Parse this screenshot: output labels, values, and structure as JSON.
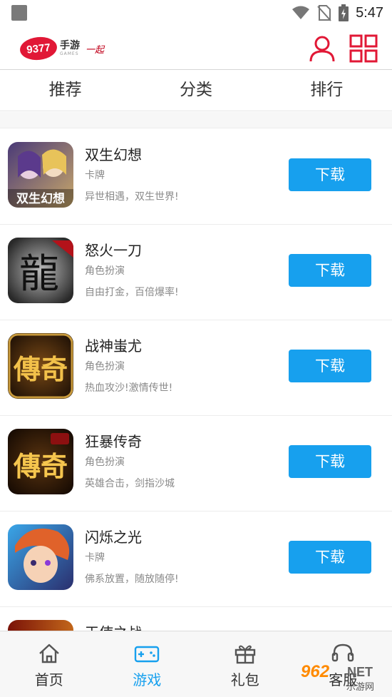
{
  "status_bar": {
    "time": "5:47",
    "icons": [
      "app-notification-icon",
      "wifi-icon",
      "no-sim-icon",
      "battery-charging-icon"
    ]
  },
  "header": {
    "logo": {
      "number": "9377",
      "text_cn": "手游",
      "text_en": "GAMES",
      "script": "一起"
    },
    "icons": [
      "user-icon",
      "grid-menu-icon"
    ],
    "accent_color": "#e11836"
  },
  "tabs": [
    {
      "label": "推荐"
    },
    {
      "label": "分类"
    },
    {
      "label": "排行"
    }
  ],
  "games": [
    {
      "name": "双生幻想",
      "category": "卡牌",
      "desc": "异世相遇，双生世界!",
      "button": "下载",
      "thumb_text": "双生幻想"
    },
    {
      "name": "怒火一刀",
      "category": "角色扮演",
      "desc": "自由打金，百倍爆率!",
      "button": "下载",
      "thumb_text": "龍"
    },
    {
      "name": "战神蚩尤",
      "category": "角色扮演",
      "desc": "热血攻沙!激情传世!",
      "button": "下载",
      "thumb_text": "傳奇"
    },
    {
      "name": "狂暴传奇",
      "category": "角色扮演",
      "desc": "英雄合击，剑指沙城",
      "button": "下载",
      "thumb_text": "傳奇"
    },
    {
      "name": "闪烁之光",
      "category": "卡牌",
      "desc": "佛系放置，随放随停!",
      "button": "下载",
      "thumb_text": ""
    },
    {
      "name": "天使之战",
      "category": "",
      "desc": "",
      "button": "",
      "thumb_text": ""
    }
  ],
  "bottom_nav": [
    {
      "label": "首页",
      "icon": "home-icon",
      "active": false
    },
    {
      "label": "游戏",
      "icon": "gamepad-icon",
      "active": true
    },
    {
      "label": "礼包",
      "icon": "gift-icon",
      "active": false
    },
    {
      "label": "客服",
      "icon": "headset-icon",
      "active": false
    }
  ],
  "watermark": {
    "number": "962",
    "suffix": ".NET",
    "text_cn": "乐游网"
  },
  "colors": {
    "primary_blue": "#17a0ee",
    "brand_red": "#e11836"
  }
}
